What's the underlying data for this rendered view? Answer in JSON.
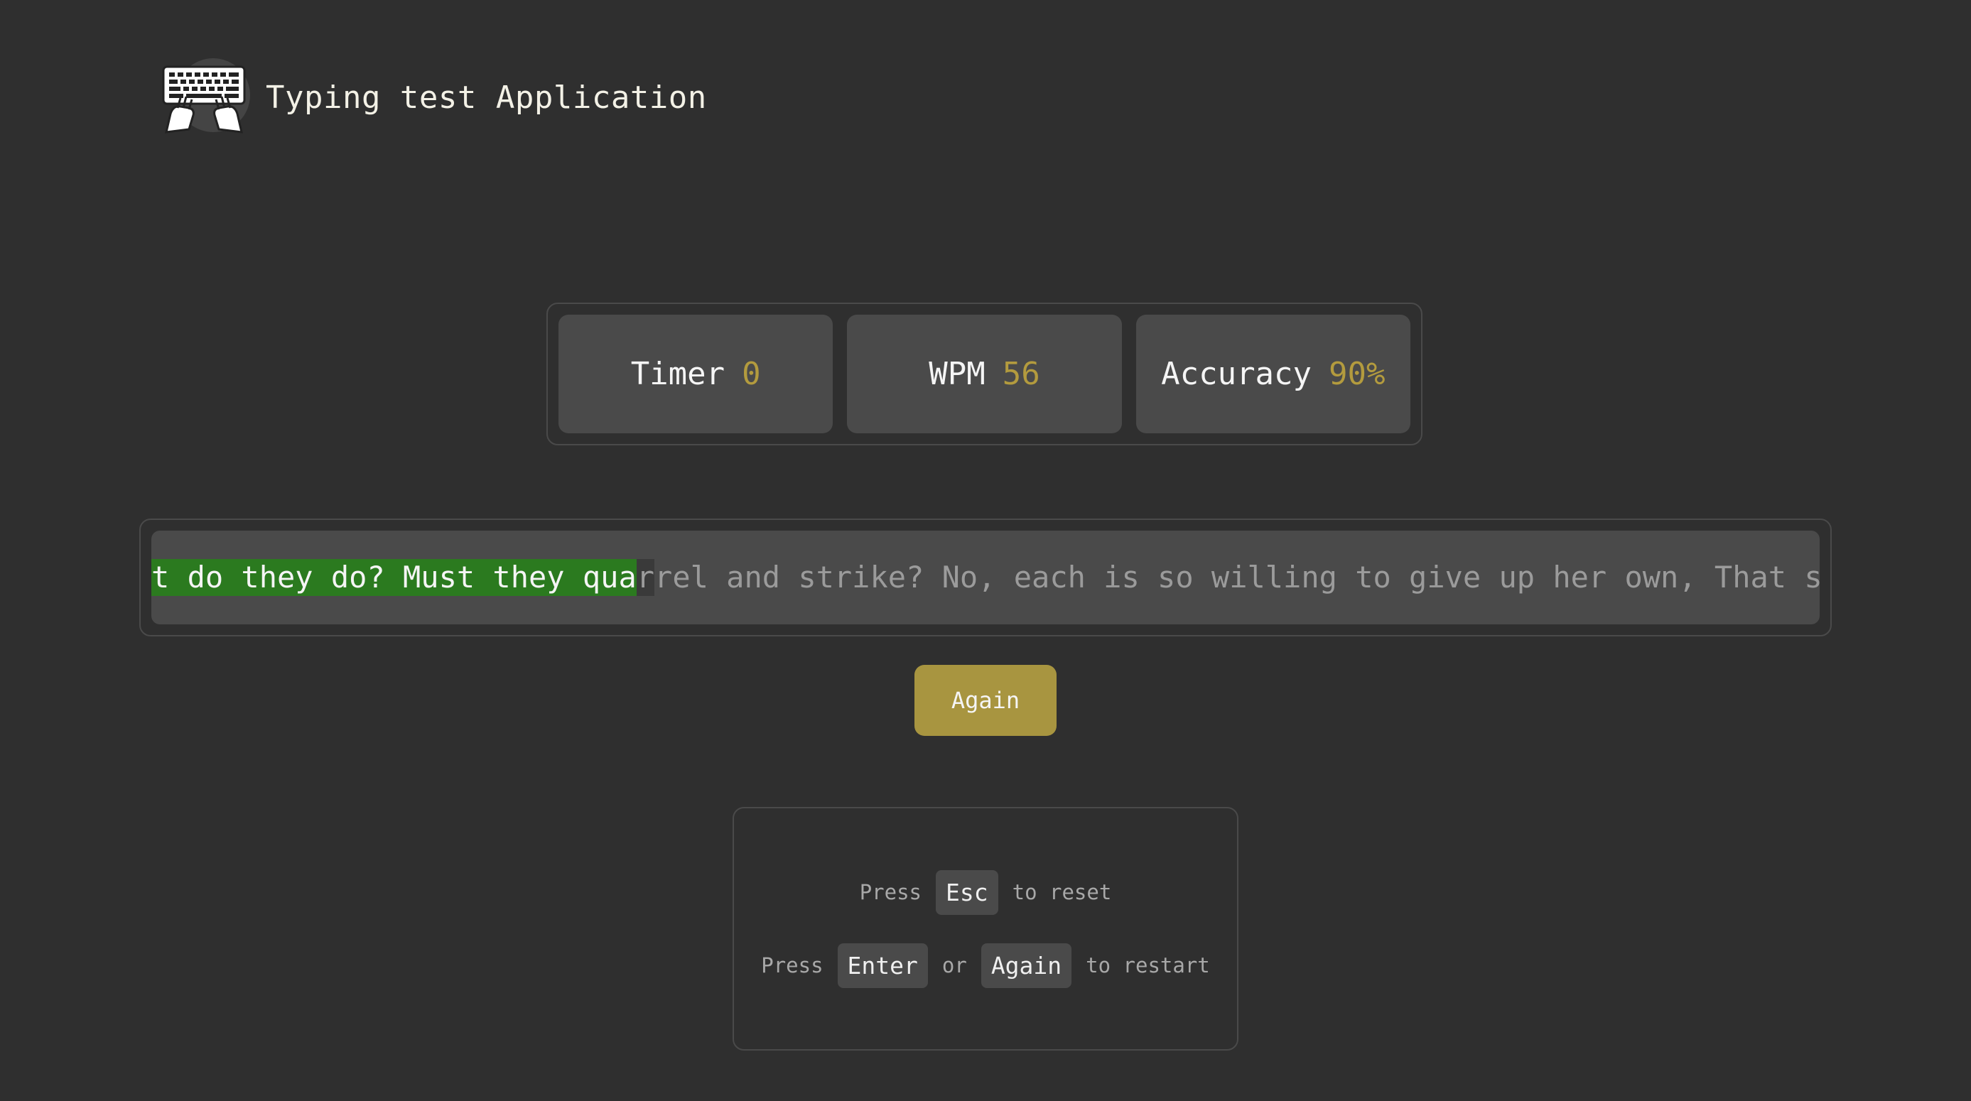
{
  "header": {
    "title": "Typing test Application"
  },
  "stats": {
    "timer_label": "Timer",
    "timer_value": "0",
    "wpm_label": "WPM",
    "wpm_value": "56",
    "accuracy_label": "Accuracy",
    "accuracy_value": "90%"
  },
  "text": {
    "typed": "t do they do? Must they qua",
    "cursor_char": "r",
    "remaining": "rel and strike? No, each is so willing to give up her own, That such d"
  },
  "again_button_label": "Again",
  "help": {
    "line1_prefix": "Press",
    "line1_key": "Esc",
    "line1_suffix": "to reset",
    "line2_prefix": "Press",
    "line2_key1": "Enter",
    "line2_or": "or",
    "line2_key2": "Again",
    "line2_suffix": "to restart"
  },
  "colors": {
    "background": "#2f2f2f",
    "panel": "#4a4a4a",
    "accent": "#b39b3e",
    "button": "#a89540",
    "typed_highlight": "#2b7a1f"
  },
  "icons": {
    "logo": "keyboard-typing-hands-icon"
  }
}
